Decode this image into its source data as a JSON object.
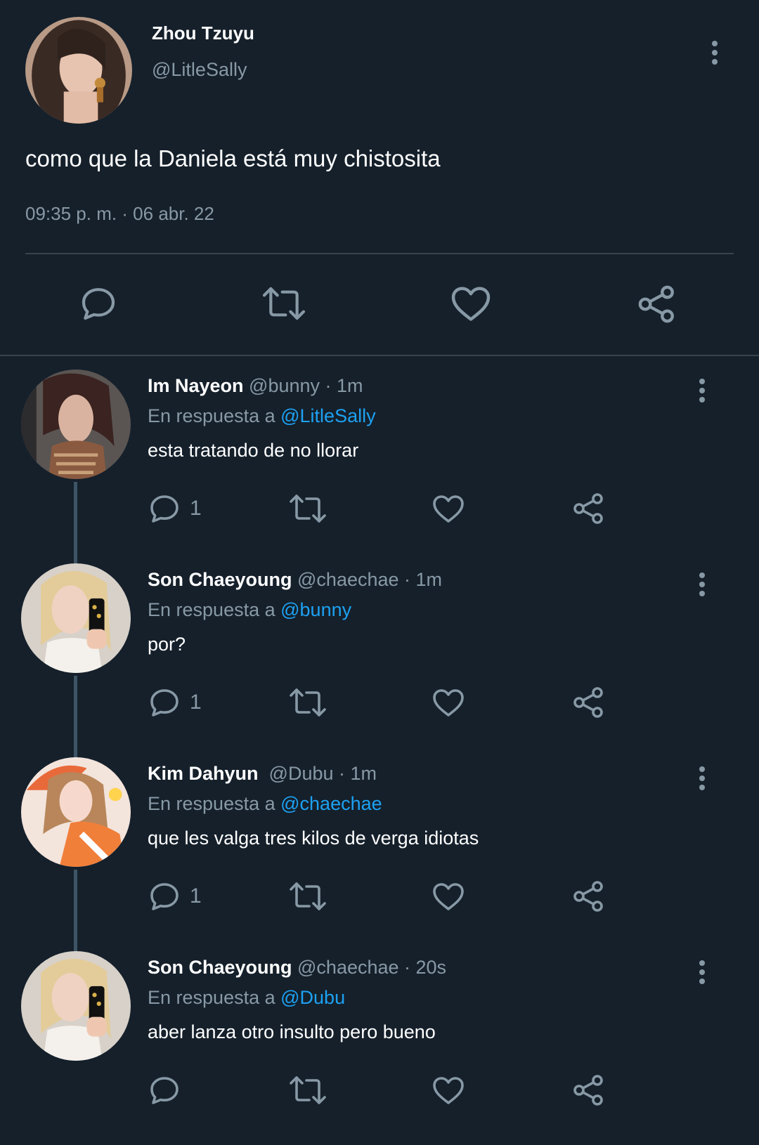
{
  "main_tweet": {
    "name": "Zhou Tzuyu",
    "handle": "@LitleSally",
    "text": "como que la Daniela está muy chistosita",
    "timestamp": "09:35 p. m. · 06 abr. 22",
    "actions": [
      "reply-icon",
      "retweet-icon",
      "like-icon",
      "share-icon"
    ]
  },
  "replies": [
    {
      "name": "Im Nayeon",
      "meta": " @bunny · 1m",
      "in_reply_prefix": "En respuesta a ",
      "in_reply_to": "@LitleSally",
      "text": "esta tratando de no llorar",
      "reply_count": "1"
    },
    {
      "name": "Son Chaeyoung",
      "meta": " @chaechae · 1m",
      "in_reply_prefix": "En respuesta a ",
      "in_reply_to": "@bunny",
      "text": "por?",
      "reply_count": "1"
    },
    {
      "name": "Kim Dahyun",
      "meta": "  @Dubu · 1m",
      "in_reply_prefix": "En respuesta a ",
      "in_reply_to": "@chaechae",
      "text": "que les valga tres kilos de verga idiotas",
      "reply_count": "1"
    },
    {
      "name": "Son Chaeyoung",
      "meta": " @chaechae · 20s",
      "in_reply_prefix": "En respuesta a ",
      "in_reply_to": "@Dubu",
      "text": "aber lanza otro insulto pero bueno",
      "reply_count": ""
    }
  ],
  "colors": {
    "background": "#15202b",
    "muted": "#8899a6",
    "link": "#1da1f2",
    "divider": "#38444d"
  }
}
